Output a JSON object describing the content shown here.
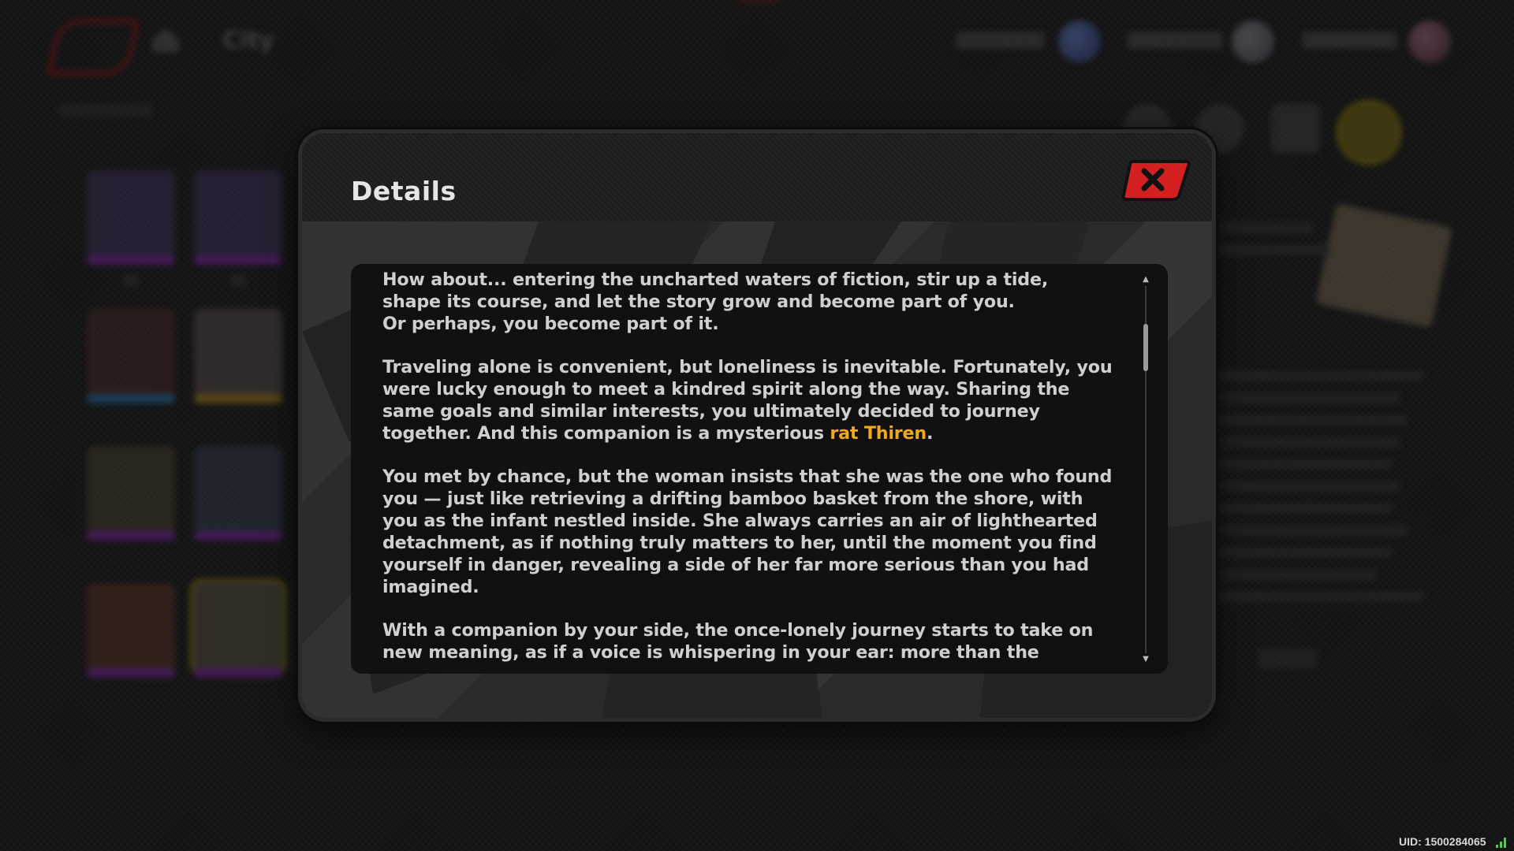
{
  "screen": {
    "nav": {
      "location_label": "City"
    }
  },
  "modal": {
    "title": "Details",
    "close_icon": "close-x-icon",
    "paragraphs": [
      {
        "lines": [
          "How about... entering the uncharted waters of fiction, stir up a tide,",
          "shape its course, and let the story grow and become part of you.",
          "Or perhaps, you become part of it."
        ]
      },
      {
        "text_before": "Traveling alone is convenient, but loneliness is inevitable. Fortunately, you were lucky enough to meet a kindred spirit along the way. Sharing the same goals and similar interests, you ultimately decided to journey together. And this companion is a mysterious ",
        "highlight": "rat Thiren",
        "text_after": "."
      },
      {
        "text": "You met by chance, but the woman insists that she was the one who found you — just like retrieving a drifting bamboo basket from the shore, with you as the infant nestled inside. She always carries an air of lighthearted detachment, as if nothing truly matters to her, until the moment you find yourself in danger, revealing a side of her far more serious than you had imagined."
      },
      {
        "text": "With a companion by your side, the once-lonely journey starts to take on new meaning, as if a voice is whispering in your ear: more than the"
      }
    ],
    "scroll_position": 0.05
  },
  "footer": {
    "uid": "UID: 1500284065"
  },
  "colors": {
    "highlight": "#f0a81c",
    "close_button": "#d42020",
    "text": "#cfcfcf",
    "background": "#1a1a1a"
  }
}
